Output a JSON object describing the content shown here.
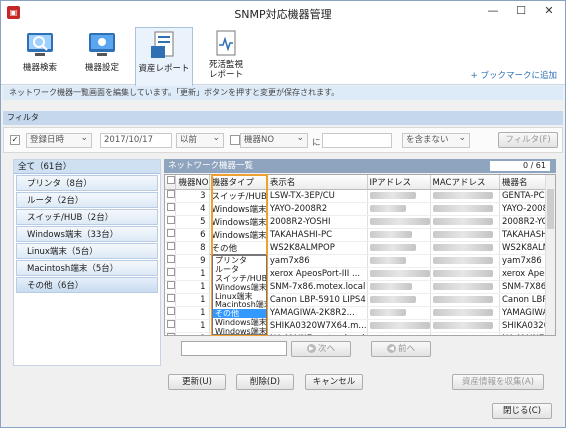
{
  "window": {
    "title": "SNMP対応機器管理",
    "minimize": "—",
    "maximize": "☐",
    "close": "✕"
  },
  "toolbar": {
    "items": [
      {
        "label": "機器検索",
        "icon": "search-icon"
      },
      {
        "label": "機器設定",
        "icon": "monitor-icon"
      },
      {
        "label": "資産レポート",
        "icon": "report-icon"
      },
      {
        "label": "死活監視\nレポート",
        "icon": "health-report-icon"
      }
    ],
    "add_bookmark": "+ ブックマークに追加"
  },
  "info_text": "ネットワーク機器一覧画面を編集しています。「更新」ボタンを押すと変更が保存されます。",
  "filter": {
    "title": "フィルタ",
    "date_field": "登録日時",
    "date_value": "2017/10/17",
    "date_op": "以前",
    "field2": "機器NO",
    "ni_label": "に",
    "condition": "を含まない",
    "filter_button": "フィルタ(F)"
  },
  "categories": {
    "all": "全て（61台）",
    "items": [
      "プリンタ（8台）",
      "ルータ（2台）",
      "スイッチ/HUB（2台）",
      "Windows端末（33台）",
      "Linux端末（5台）",
      "Macintosh端末（5台）",
      "その他（6台）"
    ]
  },
  "grid": {
    "title": "ネットワーク機器一覧",
    "count": "0 / 61",
    "columns": [
      "",
      "機器NO",
      "機器タイプ",
      "表示名",
      "IPアドレス",
      "MACアドレス",
      "機器名"
    ],
    "rows": [
      {
        "no": "3",
        "type": "スイッチ/HUB",
        "name": "LSW-TX-3EP/CU",
        "host": "GENTA-PC..."
      },
      {
        "no": "4",
        "type": "Windows端末",
        "name": "YAYO-2008R2",
        "host": "YAYO-2008"
      },
      {
        "no": "5",
        "type": "Windows端末",
        "name": "2008R2-YOSHI",
        "host": "2008R2-YO"
      },
      {
        "no": "6",
        "type": "Windows端末",
        "name": "TAKAHASHI-PC",
        "host": "TAKAHASHI"
      },
      {
        "no": "8",
        "type": "その他",
        "name": "WS2K8ALMPOP",
        "host": "WS2K8ALM"
      },
      {
        "no": "9",
        "type": "",
        "name": "yam7x86",
        "host": "yam7x86"
      },
      {
        "no": "1",
        "type": "",
        "name": "xerox ApeosPort-III ...",
        "host": "xerox Apeos"
      },
      {
        "no": "1",
        "type": "",
        "name": "SNM-7x86.motex.local",
        "host": "SNM-7X86"
      },
      {
        "no": "1",
        "type": "",
        "name": "Canon LBP-5910 LIPS4",
        "host": "Canon LBP-"
      },
      {
        "no": "1",
        "type": "",
        "name": "YAMAGIWA-2K8R2...",
        "host": "YAMAGIWA"
      },
      {
        "no": "1",
        "type": "",
        "name": "SHIKA0320W7X64.m...",
        "host": "SHIKA0320"
      },
      {
        "no": "1",
        "type": "",
        "name": "NA-MAIN7.motex.local",
        "host": "NA-MAIN7"
      }
    ]
  },
  "dropdown": {
    "options": [
      "プリンタ",
      "ルータ",
      "スイッチ/HUB",
      "Windows端末",
      "Linux端末",
      "Macintosh端末",
      "その他",
      "Windows端末",
      "Windows端末"
    ],
    "selected_index": 6
  },
  "pager": {
    "next": "次へ",
    "prev": "前へ"
  },
  "buttons": {
    "update": "更新(U)",
    "delete": "削除(D)",
    "cancel": "キャンセル",
    "collect": "資産情報を収集(A)",
    "close": "閉じる(C)"
  }
}
